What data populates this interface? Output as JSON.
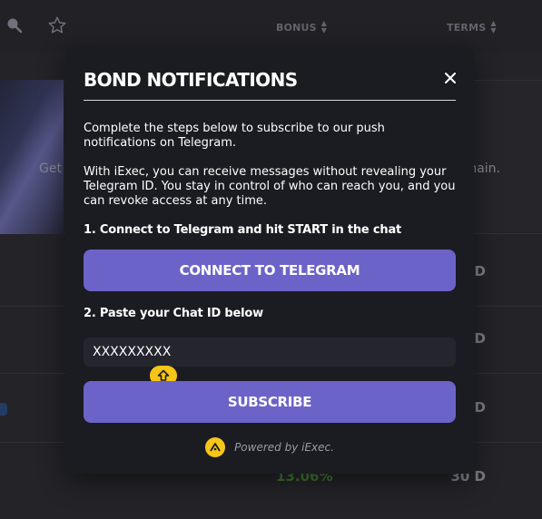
{
  "header": {
    "columns": [
      {
        "label": "BONUS"
      },
      {
        "label": "TERMS"
      }
    ]
  },
  "banner": {
    "left_fragment": "Get",
    "right_fragment": "nain."
  },
  "rows": [
    {
      "term": "D",
      "bonus": ""
    },
    {
      "term": "D",
      "bonus": ""
    },
    {
      "term": "D",
      "bonus": ""
    },
    {
      "term": "30 D",
      "bonus": "13.06%"
    }
  ],
  "modal": {
    "title": "BOND NOTIFICATIONS",
    "intro": "Complete the steps below to subscribe to our push notifications on Telegram.",
    "iexec_info": "With iExec, you can receive messages without revealing your Telegram ID. You stay in control of who can reach you, and you can revoke access at any time.",
    "step1_label": "1. Connect to Telegram and hit START in the chat",
    "connect_button": "CONNECT TO TELEGRAM",
    "step2_label": "2. Paste your Chat ID below",
    "chat_id_value": "XXXXXXXXX",
    "subscribe_button": "SUBSCRIBE",
    "powered_by": "Powered by iExec."
  },
  "colors": {
    "accent": "#6c63c9",
    "iexec_yellow": "#f5c518",
    "modal_bg": "#1b1b22",
    "bonus_green": "#4c8a3a"
  },
  "icons": {
    "search": "search-icon",
    "star": "star-icon",
    "close": "close-icon",
    "autofill": "autofill-icon",
    "iexec_logo": "iexec-logo-icon"
  }
}
